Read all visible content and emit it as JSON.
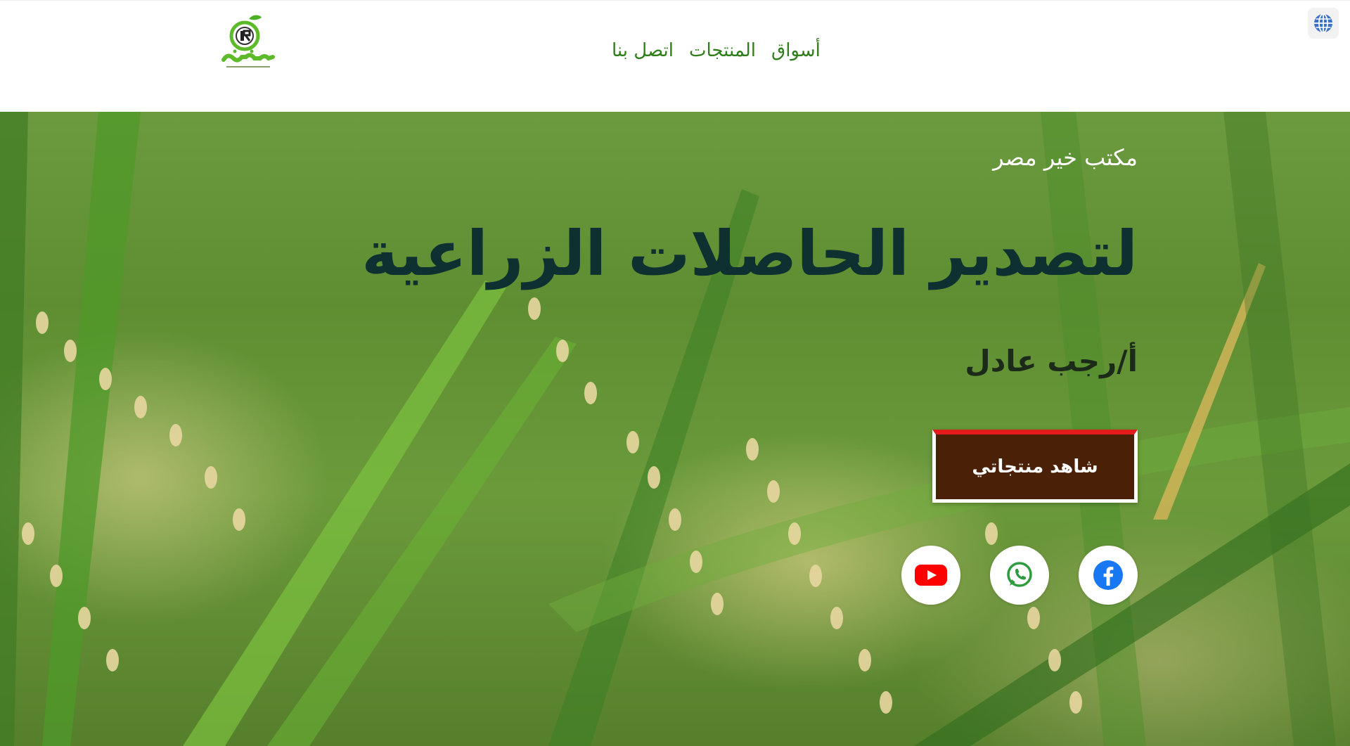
{
  "header": {
    "logo_text": "خير مصر",
    "nav": {
      "markets": "أسواق",
      "products": "المنتجات",
      "contact": "اتصل بنا"
    },
    "language_icon": "globe-icon"
  },
  "hero": {
    "subtitle": "مكتب خير مصر",
    "title": "لتصدير الحاصلات الزراعية",
    "author": "أ/رجب عادل",
    "cta_label": "شاهد منتجاتي",
    "socials": [
      {
        "name": "facebook-icon",
        "color": "#1877f2"
      },
      {
        "name": "whatsapp-icon",
        "color": "#2e9b3e"
      },
      {
        "name": "youtube-icon",
        "color": "#ff0000"
      }
    ]
  },
  "colors": {
    "nav_green": "#2e7d1a",
    "title_dark": "#0f3030",
    "cta_bg": "#4a2106",
    "cta_top_border": "#e21b1b"
  }
}
